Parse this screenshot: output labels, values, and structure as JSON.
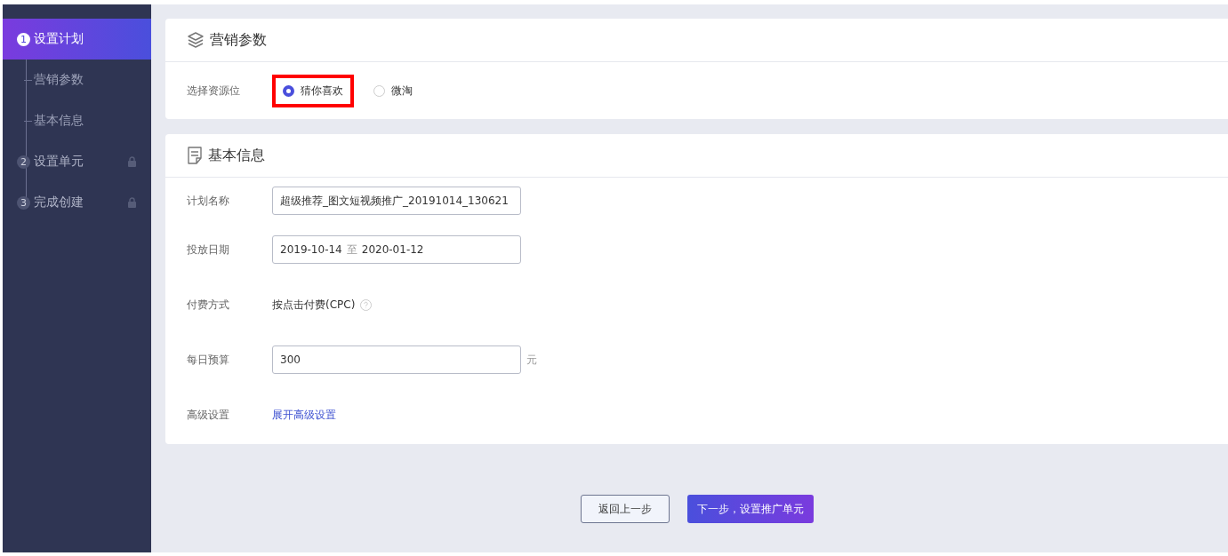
{
  "sidebar": {
    "steps": [
      {
        "number": "1",
        "label": "设置计划",
        "selected": true,
        "locked": false,
        "children": [
          {
            "label": "营销参数"
          },
          {
            "label": "基本信息"
          }
        ]
      },
      {
        "number": "2",
        "label": "设置单元",
        "selected": false,
        "locked": true
      },
      {
        "number": "3",
        "label": "完成创建",
        "selected": false,
        "locked": true
      }
    ]
  },
  "marketing": {
    "title": "营销参数",
    "label": "选择资源位",
    "options": [
      {
        "label": "猜你喜欢",
        "selected": true,
        "highlighted": true
      },
      {
        "label": "微淘",
        "selected": false,
        "highlighted": false
      }
    ]
  },
  "basic": {
    "title": "基本信息",
    "rows": [
      {
        "kind": "input",
        "label": "计划名称",
        "value": "超级推荐_图文短视频推广_20191014_130621"
      },
      {
        "kind": "daterange",
        "label": "投放日期",
        "start": "2019-10-14",
        "separator": "至",
        "end": "2020-01-12"
      },
      {
        "kind": "text",
        "label": "付费方式",
        "value": "按点击付费(CPC)",
        "help": true
      },
      {
        "kind": "input",
        "label": "每日预算",
        "value": "300",
        "unit": "元"
      },
      {
        "kind": "link",
        "label": "高级设置",
        "value": "展开高级设置"
      }
    ]
  },
  "buttons": [
    {
      "label": "返回上一步",
      "kind": "secondary"
    },
    {
      "label": "下一步，设置推广单元",
      "kind": "primary"
    }
  ]
}
